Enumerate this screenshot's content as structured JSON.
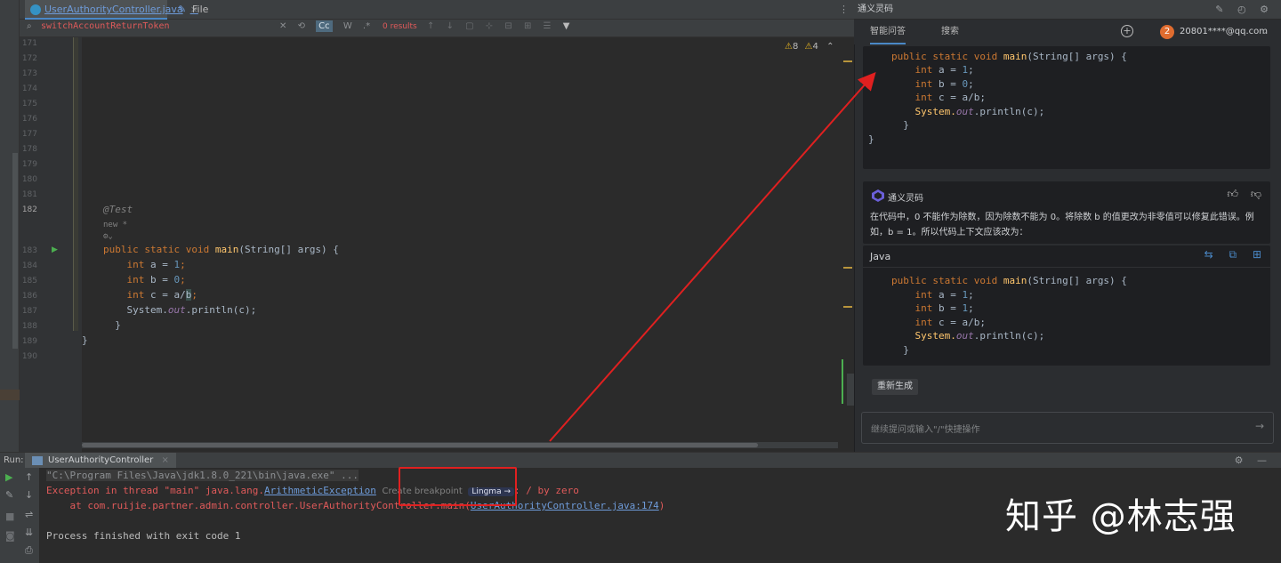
{
  "editor": {
    "tabs": [
      {
        "label": "UserAuthorityController.java",
        "close": "×"
      },
      {
        "label": "File Comparison",
        "close": "×"
      }
    ],
    "menu": "⋮",
    "search": {
      "query": "switchAccountReturnToken",
      "case_btn": "Cc",
      "word_btn": "W",
      "regex_btn": ".*",
      "results": "0 results"
    },
    "inspections": {
      "warnings": "8",
      "weak_warnings": "4"
    },
    "line_numbers": [
      "171",
      "172",
      "173",
      "174",
      "175",
      "176",
      "177",
      "178",
      "179",
      "180",
      "181",
      "182",
      "183",
      "184",
      "185",
      "186",
      "187",
      "188",
      "189",
      "190"
    ],
    "annotation": "@Test",
    "new_hint": "new *",
    "code": {
      "l183_kw": "public static void",
      "l183_fn": "main",
      "l183_rest": "(String[] args) {",
      "int_kw": "int",
      "l184_var": " a = ",
      "l184_val": "1",
      "l185_var": " b = ",
      "l185_val": "0",
      "l186_var": " c = a/",
      "l186_b": "b",
      "println_pre": "System.",
      "println_out": "out",
      "println_post": ".println(c);",
      "close1": "}",
      "close2": "}",
      "semi": ";"
    }
  },
  "assistant": {
    "title": "通义灵码",
    "tabs": [
      "智能问答",
      "搜索"
    ],
    "user_badge": "2",
    "user_name": "20801****@qq.com",
    "question_code": {
      "l1_kw": "public static void",
      "l1_fn": "main",
      "l1_rest": "(String[] args) {",
      "int_kw": "int",
      "a": " a = ",
      "a_val": "1",
      "b": " b = ",
      "b_val": "0",
      "c": " c = a/b;",
      "sys": "System.",
      "out": "out",
      "println": ".println(c);",
      "close1": "}",
      "close2": "}"
    },
    "ai_name": "通义灵码",
    "answer_text": "在代码中，0 不能作为除数，因为除数不能为 0。将除数 b 的值更改为非零值可以修复此错误。例如，b = 1。所以代码上下文应该改为：",
    "code_lang": "Java",
    "answer_code": {
      "l1_kw": "public static void",
      "l1_fn": "main",
      "l1_rest": "(String[] args) {",
      "int_kw": "int",
      "a": " a = ",
      "a_val": "1",
      "b": " b = ",
      "b_val": "1",
      "c": " c = a/b;",
      "sys": "System.",
      "out": "out",
      "println": ".println(c);",
      "close1": "}"
    },
    "regenerate": "重新生成",
    "input_placeholder": "继续提问或输入\"/\"快捷操作",
    "send": "→"
  },
  "run": {
    "label": "Run:",
    "tab": "UserAuthorityController",
    "tab_close": "×",
    "cmd": "\"C:\\Program Files\\Java\\jdk1.8.0_221\\bin\\java.exe\" ...",
    "exception_prefix": "Exception in thread \"main\" java.lang.",
    "exception_class": "ArithmeticException",
    "create_breakpoint": "Create breakpoint",
    "lingma_chip": "Lingma →",
    "exception_suffix": ": / by zero",
    "stack_prefix": "    at com.ruijie.partner.admin.controller.UserAuthorityController.main(",
    "stack_link": "UserAuthorityController.java:174",
    "stack_suffix": ")",
    "finished": "Process finished with exit code 1"
  },
  "watermark": "知乎 @林志强",
  "colors": {
    "accent": "#4a88c7",
    "error": "#e05a5a",
    "annotation_red": "#e02020"
  }
}
